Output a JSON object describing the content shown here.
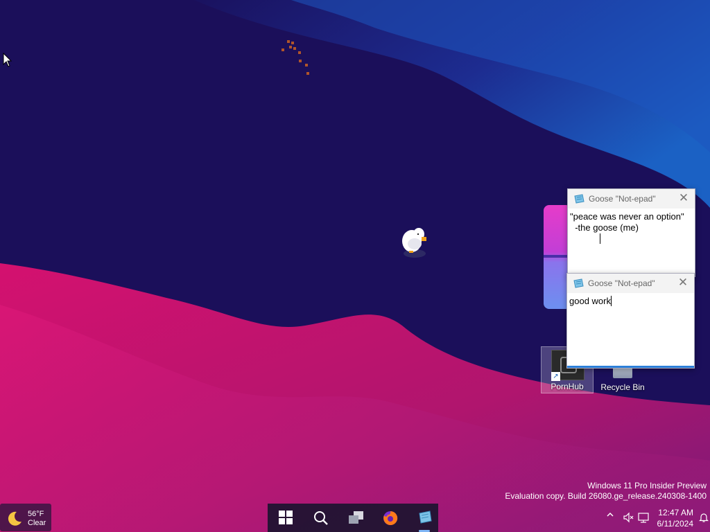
{
  "desktop": {
    "icons": [
      {
        "label": "PornHub",
        "icon": "shortcut-icon"
      },
      {
        "label": "Recycle Bin",
        "icon": "recycle-bin-icon"
      }
    ]
  },
  "notepads": [
    {
      "title": "Goose \"Not-epad\"",
      "text": "\"peace was never an option\"\n  -the goose (me)\n            "
    },
    {
      "title": "Goose \"Not-epad\"",
      "text": "good work"
    }
  ],
  "watermark": {
    "line1": "Windows 11 Pro Insider Preview",
    "line2": "Evaluation copy. Build 26080.ge_release.240308-1400"
  },
  "taskbar": {
    "weather": {
      "temp": "56°F",
      "condition": "Clear",
      "icon": "moon-icon"
    },
    "pinned": [
      "start-icon",
      "search-icon",
      "task-view-icon",
      "firefox-icon",
      "notepad-icon"
    ],
    "clock": {
      "time": "12:47 AM",
      "date": "6/11/2024"
    }
  },
  "colors": {
    "accent": "#2c7fd9",
    "wallpaper_dark": "#1b0f5a",
    "wallpaper_pink": "#d11a72"
  }
}
